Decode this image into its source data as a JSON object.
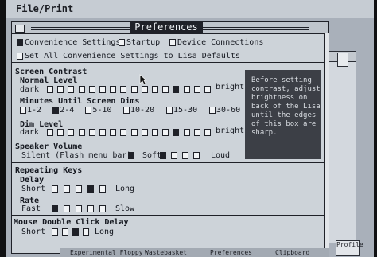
{
  "menubar": {
    "file_print": "File/Print"
  },
  "window": {
    "title": "Preferences"
  },
  "tabs": {
    "convenience": "Convenience Settings",
    "startup": "Startup",
    "device": "Device Connections"
  },
  "set_all": "Set All Convenience Settings to Lisa Defaults",
  "contrast": {
    "section": "Screen Contrast",
    "normal_level": "Normal Level",
    "dark": "dark",
    "bright": "bright",
    "selected_index": 12
  },
  "dim_time": {
    "heading": "Minutes Until Screen Dims",
    "options": [
      "1-2",
      "2-4",
      "5-10",
      "10-20",
      "15-30",
      "30-60"
    ],
    "selected": "2-4"
  },
  "dim_level": {
    "heading": "Dim Level",
    "dark": "dark",
    "bright": "bright",
    "selected_index": 12
  },
  "speaker": {
    "heading": "Speaker Volume",
    "silent": "Silent (Flash menu bar)",
    "soft": "Soft",
    "loud": "Loud",
    "selected_index": 0
  },
  "repeat": {
    "heading": "Repeating Keys",
    "delay_label": "Delay",
    "delay_short": "Short",
    "delay_long": "Long",
    "rate_label": "Rate",
    "rate_fast": "Fast",
    "rate_slow": "Slow"
  },
  "mouse": {
    "heading": "Mouse Double Click Delay",
    "short": "Short",
    "long": "Long"
  },
  "hint": {
    "lines": [
      "Before setting",
      "contrast, adjust",
      "brightness on",
      "back of the Lisa",
      "until the edges",
      "of this box are",
      "sharp."
    ]
  },
  "bottom_tabs": [
    "Experimental Floppy",
    "Wastebasket",
    "Preferences",
    "Clipboard"
  ],
  "profile_label": "Profile"
}
